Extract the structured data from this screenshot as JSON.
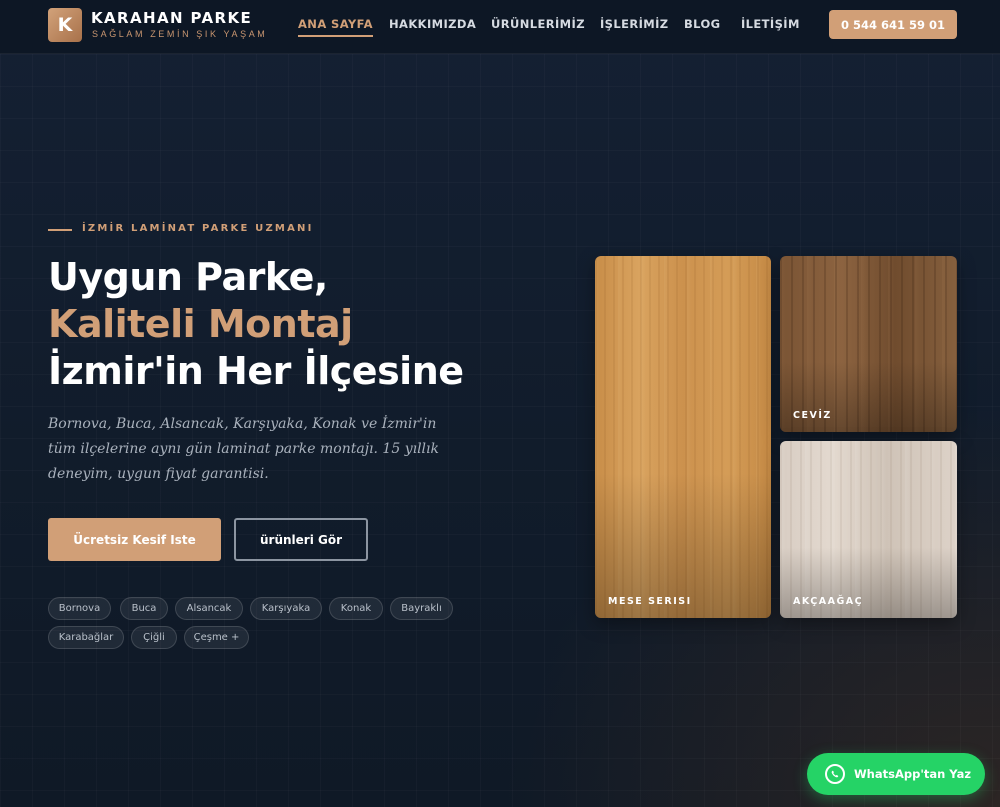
{
  "brand": {
    "logo_letter": "K",
    "name": "KARAHAN PARKE",
    "tagline": "SAĞLAM ZEMİN ŞIK YAŞAM"
  },
  "nav": {
    "items": [
      {
        "label": "ANA SAYFA",
        "active": true
      },
      {
        "label": "HAKKIMIZDA",
        "active": false
      },
      {
        "label": "ÜRÜNLERİMİZ",
        "active": false
      },
      {
        "label": "İŞLERİMİZ",
        "active": false
      },
      {
        "label": "BLOG",
        "active": false
      },
      {
        "label": "İLETİŞİM",
        "active": false
      }
    ],
    "phone": "0 544 641 59 01"
  },
  "hero": {
    "eyebrow": "İZMİR LAMİNAT PARKE UZMANI",
    "title_line1": "Uygun Parke,",
    "title_line2": "Kaliteli Montaj",
    "title_line3": "İzmir'in Her İlçesine",
    "lead": "Bornova, Buca, Alsancak, Karşıyaka, Konak ve İzmir'in tüm ilçelerine aynı gün laminat parke montajı. 15 yıllık deneyim, uygun fiyat garantisi.",
    "cta_primary": "Ücretsiz Kesif Iste",
    "cta_secondary": "ürünleri Gör",
    "districts": [
      "Bornova",
      "Buca",
      "Alsancak",
      "Karşıyaka",
      "Konak",
      "Bayraklı",
      "Karabağlar",
      "Çiğli",
      "Çeşme +"
    ]
  },
  "products": [
    {
      "label": "MESE SERISI",
      "finish": "oak"
    },
    {
      "label": "CEVİZ",
      "finish": "walnut"
    },
    {
      "label": "AKÇAAĞAÇ",
      "finish": "maple"
    }
  ],
  "whatsapp": {
    "label": "WhatsApp'tan Yaz"
  },
  "colors": {
    "accent": "#d19f77",
    "background": "#0f1a28",
    "whatsapp": "#25d366"
  }
}
